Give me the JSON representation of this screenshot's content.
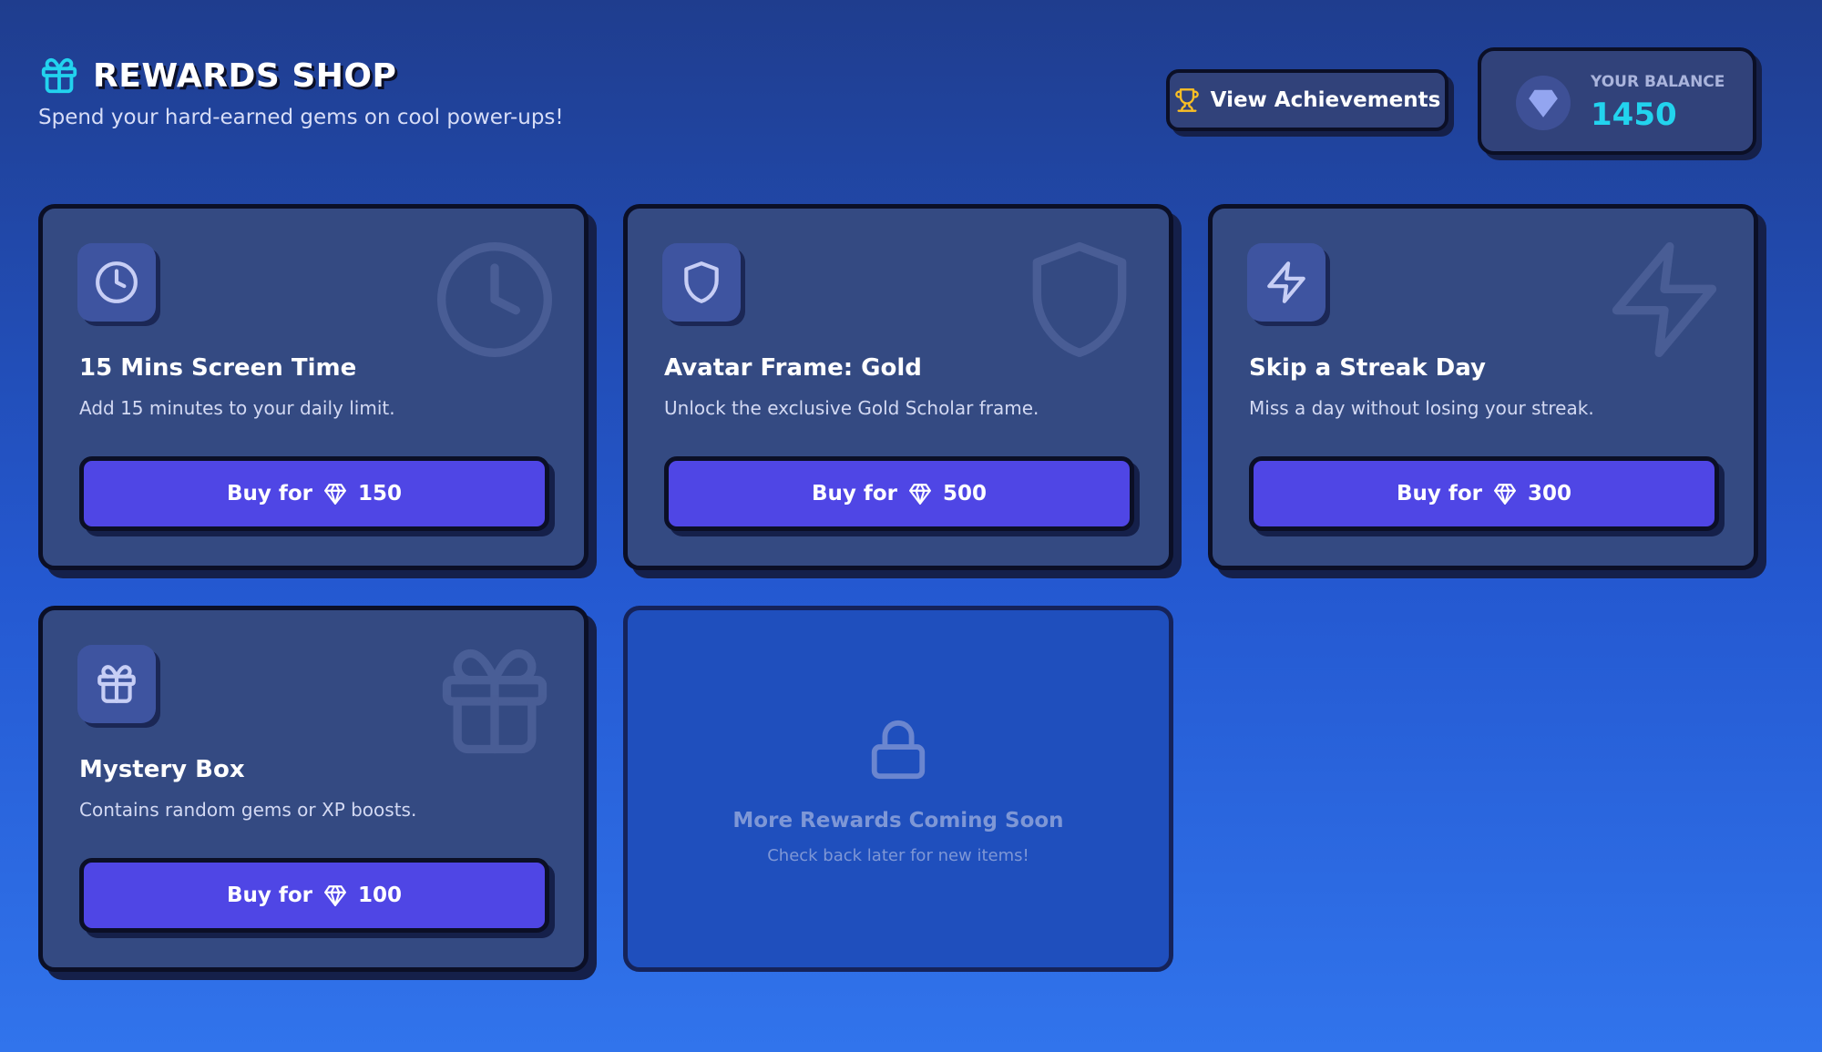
{
  "header": {
    "title": "REWARDS SHOP",
    "subtitle": "Spend your hard-earned gems on cool power-ups!",
    "icon": "gift-icon"
  },
  "achievements_button": {
    "label": "View Achievements",
    "icon": "trophy-icon"
  },
  "balance": {
    "label": "YOUR BALANCE",
    "value": "1450",
    "icon": "gem-icon"
  },
  "buy_label": "Buy for",
  "items": [
    {
      "title": "15 Mins Screen Time",
      "description": "Add 15 minutes to your daily limit.",
      "price": "150",
      "icon": "clock-icon"
    },
    {
      "title": "Avatar Frame: Gold",
      "description": "Unlock the exclusive Gold Scholar frame.",
      "price": "500",
      "icon": "shield-icon"
    },
    {
      "title": "Skip a Streak Day",
      "description": "Miss a day without losing your streak.",
      "price": "300",
      "icon": "lightning-icon"
    },
    {
      "title": "Mystery Box",
      "description": "Contains random gems or XP boosts.",
      "price": "100",
      "icon": "gift-icon"
    }
  ],
  "coming_soon": {
    "title": "More Rewards Coming Soon",
    "subtitle": "Check back later for new items!",
    "icon": "lock-icon"
  },
  "colors": {
    "accent": "#4f46e5",
    "gem": "#22d3ee",
    "card": "#344a82",
    "outline": "#0b0f26",
    "trophy": "#fbbf24"
  }
}
